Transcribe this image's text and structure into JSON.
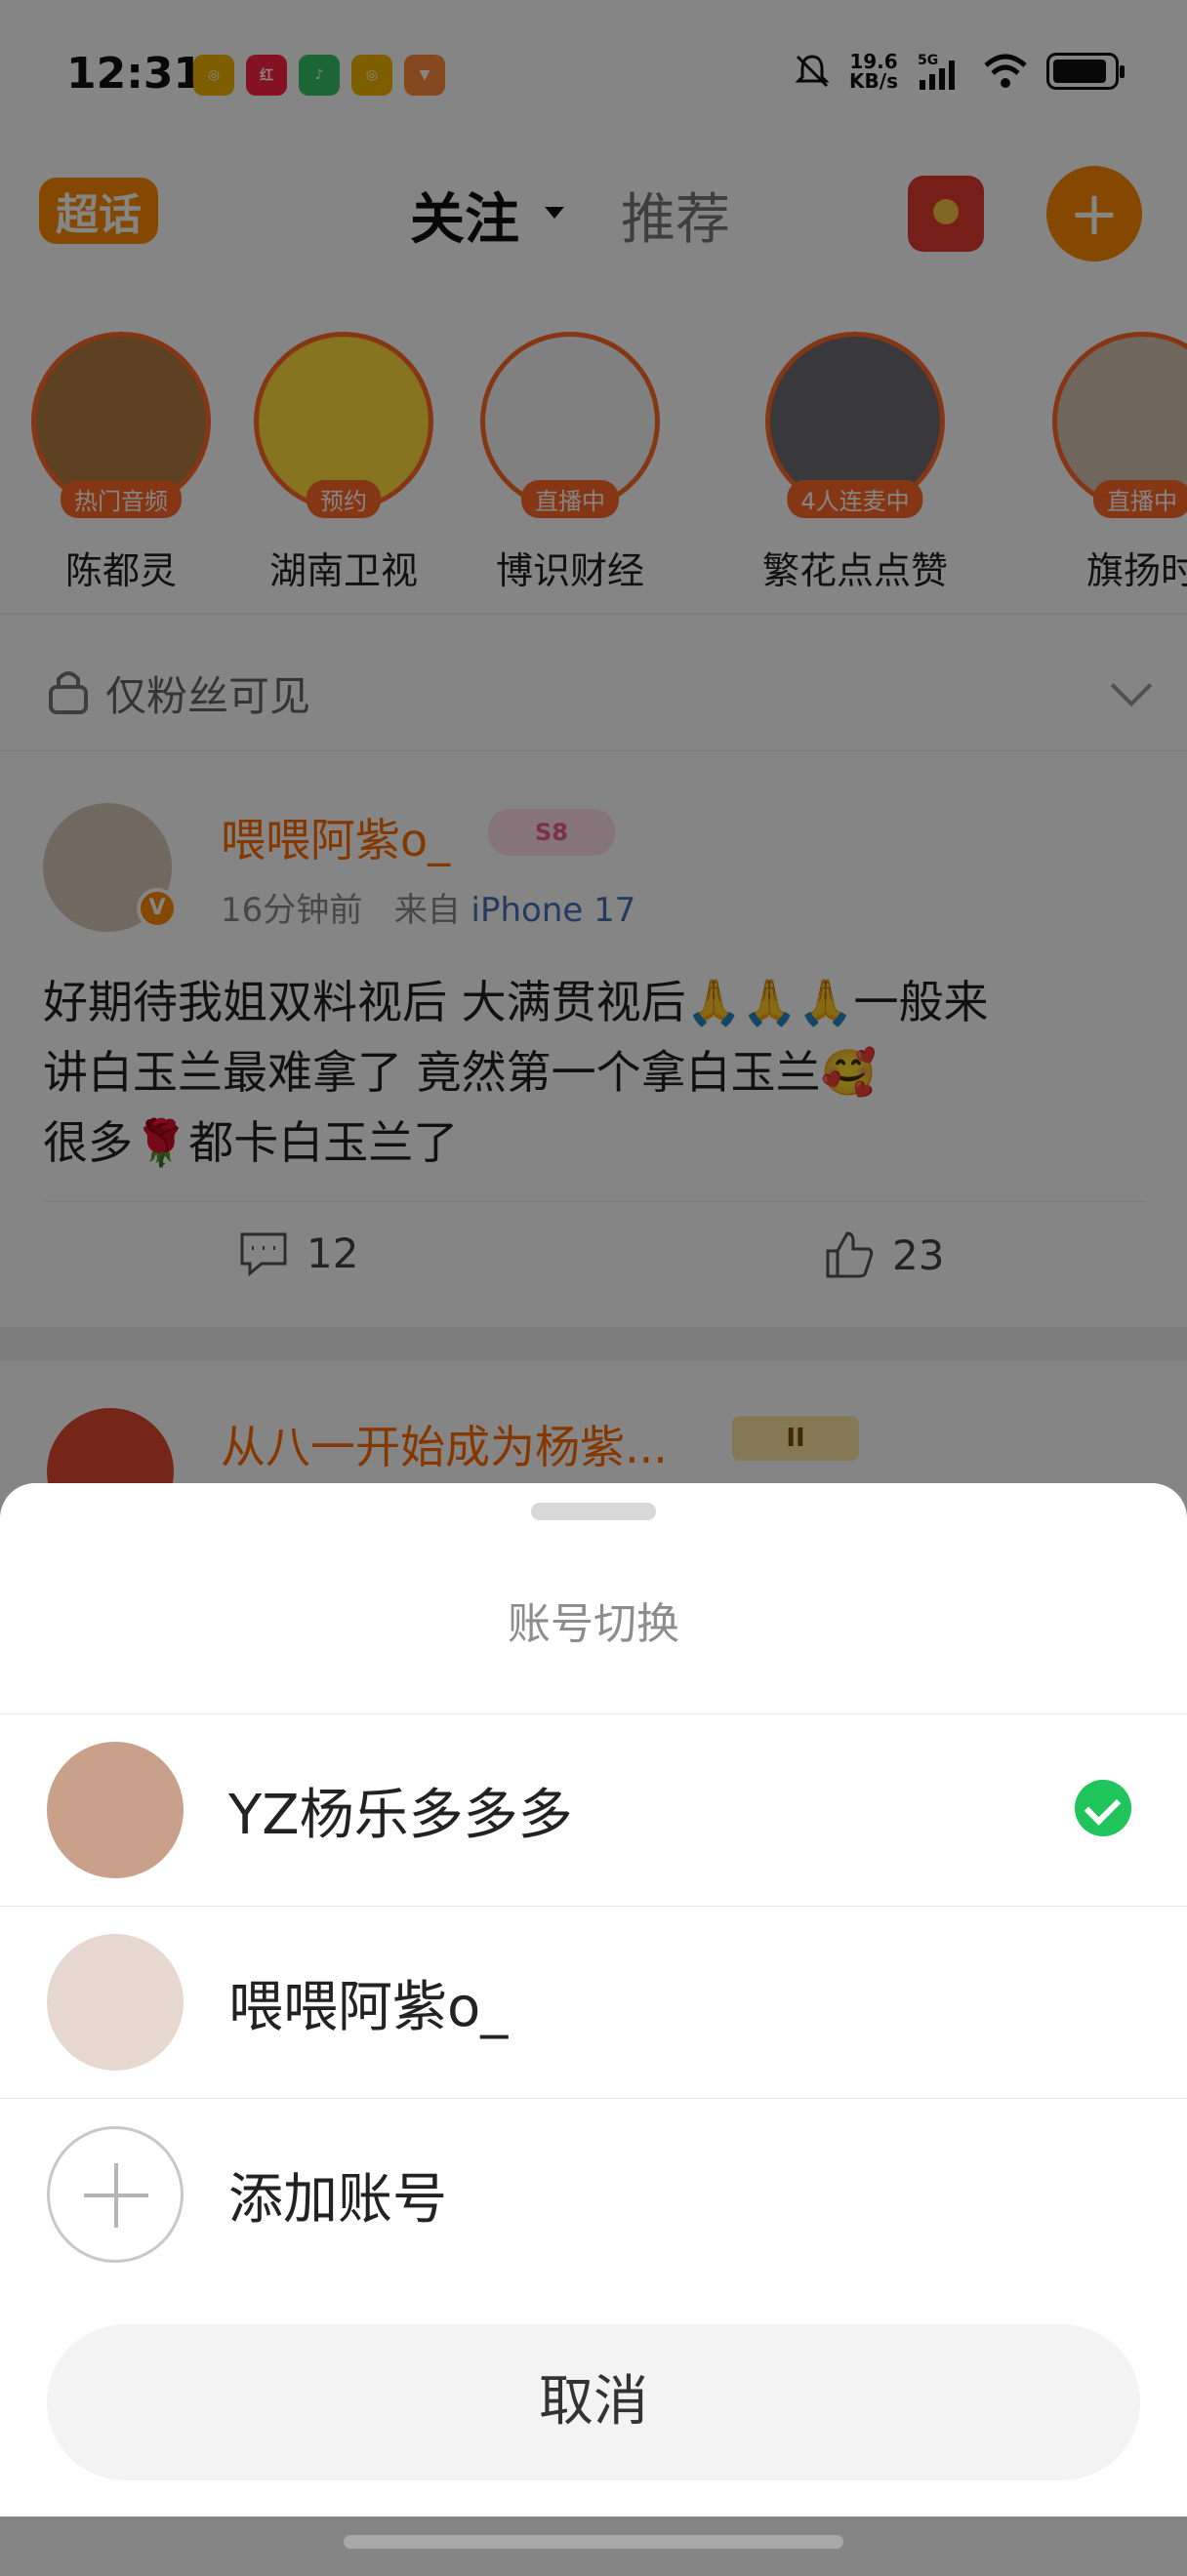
{
  "status_bar": {
    "time": "12:31",
    "net_speed_value": "19.6",
    "net_speed_unit": "KB/s",
    "network": "5G",
    "notif_icons": [
      "weibo-icon",
      "xiaohongshu-icon",
      "qq-music-icon",
      "weibo-icon",
      "app-icon"
    ]
  },
  "header": {
    "logo": "超话",
    "tabs": [
      {
        "label": "关注",
        "active": true
      },
      {
        "label": "推荐",
        "active": false
      }
    ]
  },
  "stories": [
    {
      "name": "陈都灵",
      "badge": "热门音频"
    },
    {
      "name": "湖南卫视",
      "badge": "预约"
    },
    {
      "name": "博识财经",
      "badge": "直播中"
    },
    {
      "name": "繁花点点赞",
      "badge": "4人连麦中"
    },
    {
      "name": "旗扬时",
      "badge": "直播中"
    }
  ],
  "fans_visible": "仅粉丝可见",
  "post": {
    "username": "喂喂阿紫o_",
    "level_badge": "S8",
    "meta_time": "16分钟前",
    "meta_from": "来自",
    "meta_device": "iPhone 17",
    "text_lines": [
      "好期待我姐双料视后 大满贯视后🙏🙏🙏一般来",
      "讲白玉兰最难拿了 竟然第一个拿白玉兰🥰",
      "很多🌹都卡白玉兰了"
    ],
    "comment_count": "12",
    "like_count": "23"
  },
  "post2": {
    "username": "从八一开始成为杨紫...",
    "crown_badge": "II"
  },
  "sheet": {
    "title": "账号切换",
    "accounts": [
      {
        "name": "YZ杨乐多多多",
        "selected": true
      },
      {
        "name": "喂喂阿紫o_",
        "selected": false
      }
    ],
    "add_label": "添加账号",
    "cancel_label": "取消"
  },
  "colors": {
    "accent_orange": "#ff8a00",
    "check_green": "#1fc45a",
    "overlay": "rgba(0,0,0,0.48)"
  }
}
